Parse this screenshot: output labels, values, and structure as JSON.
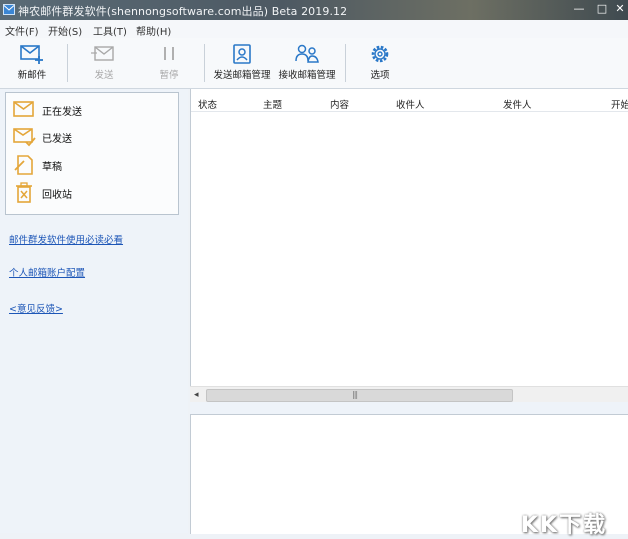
{
  "window": {
    "title": "神农邮件群发软件(shennongsoftware.com出品) Beta 2019.12",
    "min_glyph": "—",
    "max_glyph": "□",
    "close_glyph": "✕"
  },
  "menu": [
    "文件(F)",
    "开始(S)",
    "工具(T)",
    "帮助(H)"
  ],
  "toolbar": {
    "new_mail": "新邮件",
    "send": "发送",
    "pause": "暂停",
    "send_mailbox_mgmt": "发送邮箱管理",
    "recv_mailbox_mgmt": "接收邮箱管理",
    "options": "选项"
  },
  "folders": [
    {
      "label": "正在发送",
      "icon": "envelope-sending-icon"
    },
    {
      "label": "已发送",
      "icon": "envelope-sent-icon"
    },
    {
      "label": "草稿",
      "icon": "draft-icon"
    },
    {
      "label": "回收站",
      "icon": "trash-icon"
    }
  ],
  "links": {
    "must_read": "邮件群发软件使用必读必看",
    "account_config": "个人邮箱账户配置",
    "feedback": "<意见反馈>"
  },
  "list": {
    "columns": [
      "状态",
      "主题",
      "内容",
      "收件人",
      "发件人",
      "开始"
    ]
  },
  "scrollbar": {
    "left_arrow": "◂",
    "grip": "|||"
  },
  "watermark": "KK下载",
  "colors": {
    "accent": "#2a78c8",
    "folder_icon": "#e4a63a",
    "link": "#1d56b7",
    "disabled": "#a8a8a8"
  }
}
